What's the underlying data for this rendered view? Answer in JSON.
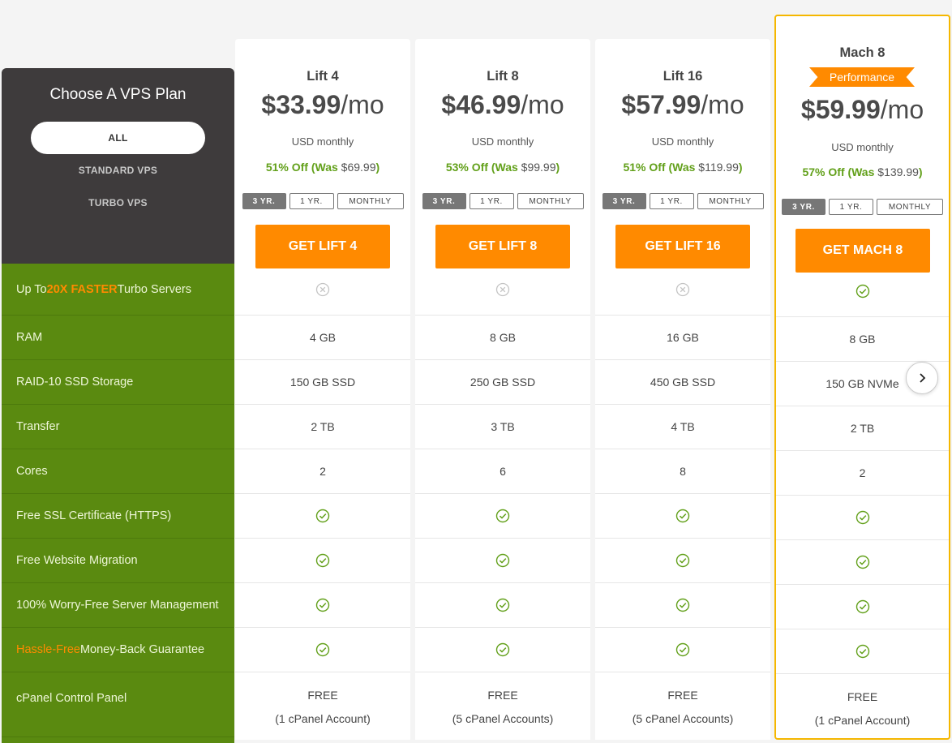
{
  "sidebar": {
    "title": "Choose A VPS Plan",
    "filters": [
      {
        "label": "ALL",
        "active": true
      },
      {
        "label": "STANDARD VPS"
      },
      {
        "label": "TURBO VPS"
      }
    ]
  },
  "features": [
    {
      "parts": [
        {
          "t": "Up To "
        },
        {
          "t": "20X FASTER",
          "style": "hlb"
        },
        {
          "t": " Turbo Servers"
        }
      ]
    },
    {
      "parts": [
        {
          "t": "RAM"
        }
      ]
    },
    {
      "parts": [
        {
          "t": "RAID-10 SSD Storage"
        }
      ]
    },
    {
      "parts": [
        {
          "t": "Transfer"
        }
      ]
    },
    {
      "parts": [
        {
          "t": "Cores"
        }
      ]
    },
    {
      "parts": [
        {
          "t": "Free SSL Certificate (HTTPS)"
        }
      ]
    },
    {
      "parts": [
        {
          "t": "Free Website Migration"
        }
      ]
    },
    {
      "parts": [
        {
          "t": "100% Worry-Free Server Management"
        }
      ]
    },
    {
      "parts": [
        {
          "t": "Hassle-Free",
          "style": "hl"
        },
        {
          "t": " Money-Back Guarantee"
        }
      ]
    },
    {
      "parts": [
        {
          "t": "cPanel Control Panel"
        }
      ]
    }
  ],
  "terms": [
    "3 YR.",
    "1 YR.",
    "MONTHLY"
  ],
  "plans": [
    {
      "name": "Lift 4",
      "price": "$33.99",
      "per": "/mo",
      "usd": "USD monthly",
      "discount": "51% Off (Was ",
      "was": "$69.99",
      "close": ")",
      "cta": "GET LIFT 4",
      "cells": [
        "x",
        "4 GB",
        "150 GB SSD",
        "2 TB",
        "2",
        "check",
        "check",
        "check",
        "check"
      ],
      "cpanel": [
        "FREE",
        "(1 cPanel Account)"
      ]
    },
    {
      "name": "Lift 8",
      "price": "$46.99",
      "per": "/mo",
      "usd": "USD monthly",
      "discount": "53% Off (Was ",
      "was": "$99.99",
      "close": ")",
      "cta": "GET LIFT 8",
      "cells": [
        "x",
        "8 GB",
        "250 GB SSD",
        "3 TB",
        "6",
        "check",
        "check",
        "check",
        "check"
      ],
      "cpanel": [
        "FREE",
        "(5 cPanel Accounts)"
      ]
    },
    {
      "name": "Lift 16",
      "price": "$57.99",
      "per": "/mo",
      "usd": "USD monthly",
      "discount": "51% Off (Was ",
      "was": "$119.99",
      "close": ")",
      "cta": "GET LIFT 16",
      "cells": [
        "x",
        "16 GB",
        "450 GB SSD",
        "4 TB",
        "8",
        "check",
        "check",
        "check",
        "check"
      ],
      "cpanel": [
        "FREE",
        "(5 cPanel Accounts)"
      ]
    },
    {
      "name": "Mach 8",
      "badge": "Performance",
      "featured": true,
      "price": "$59.99",
      "per": "/mo",
      "usd": "USD monthly",
      "discount": "57% Off (Was ",
      "was": "$139.99",
      "close": ")",
      "cta": "GET MACH 8",
      "cells": [
        "check",
        "8 GB",
        "150 GB NVMe",
        "2 TB",
        "2",
        "check",
        "check",
        "check",
        "check"
      ],
      "cpanel": [
        "FREE",
        "(1 cPanel Account)"
      ]
    }
  ],
  "colors": {
    "accent": "#ff8a00",
    "feature_bg": "#5a8a10",
    "sidebar_bg": "#3e3b3c",
    "check": "#62a01a",
    "featured_border": "#f5b700"
  },
  "icons": {
    "included": "check-circle-icon",
    "excluded": "x-circle-icon",
    "next": "chevron-right-icon"
  }
}
